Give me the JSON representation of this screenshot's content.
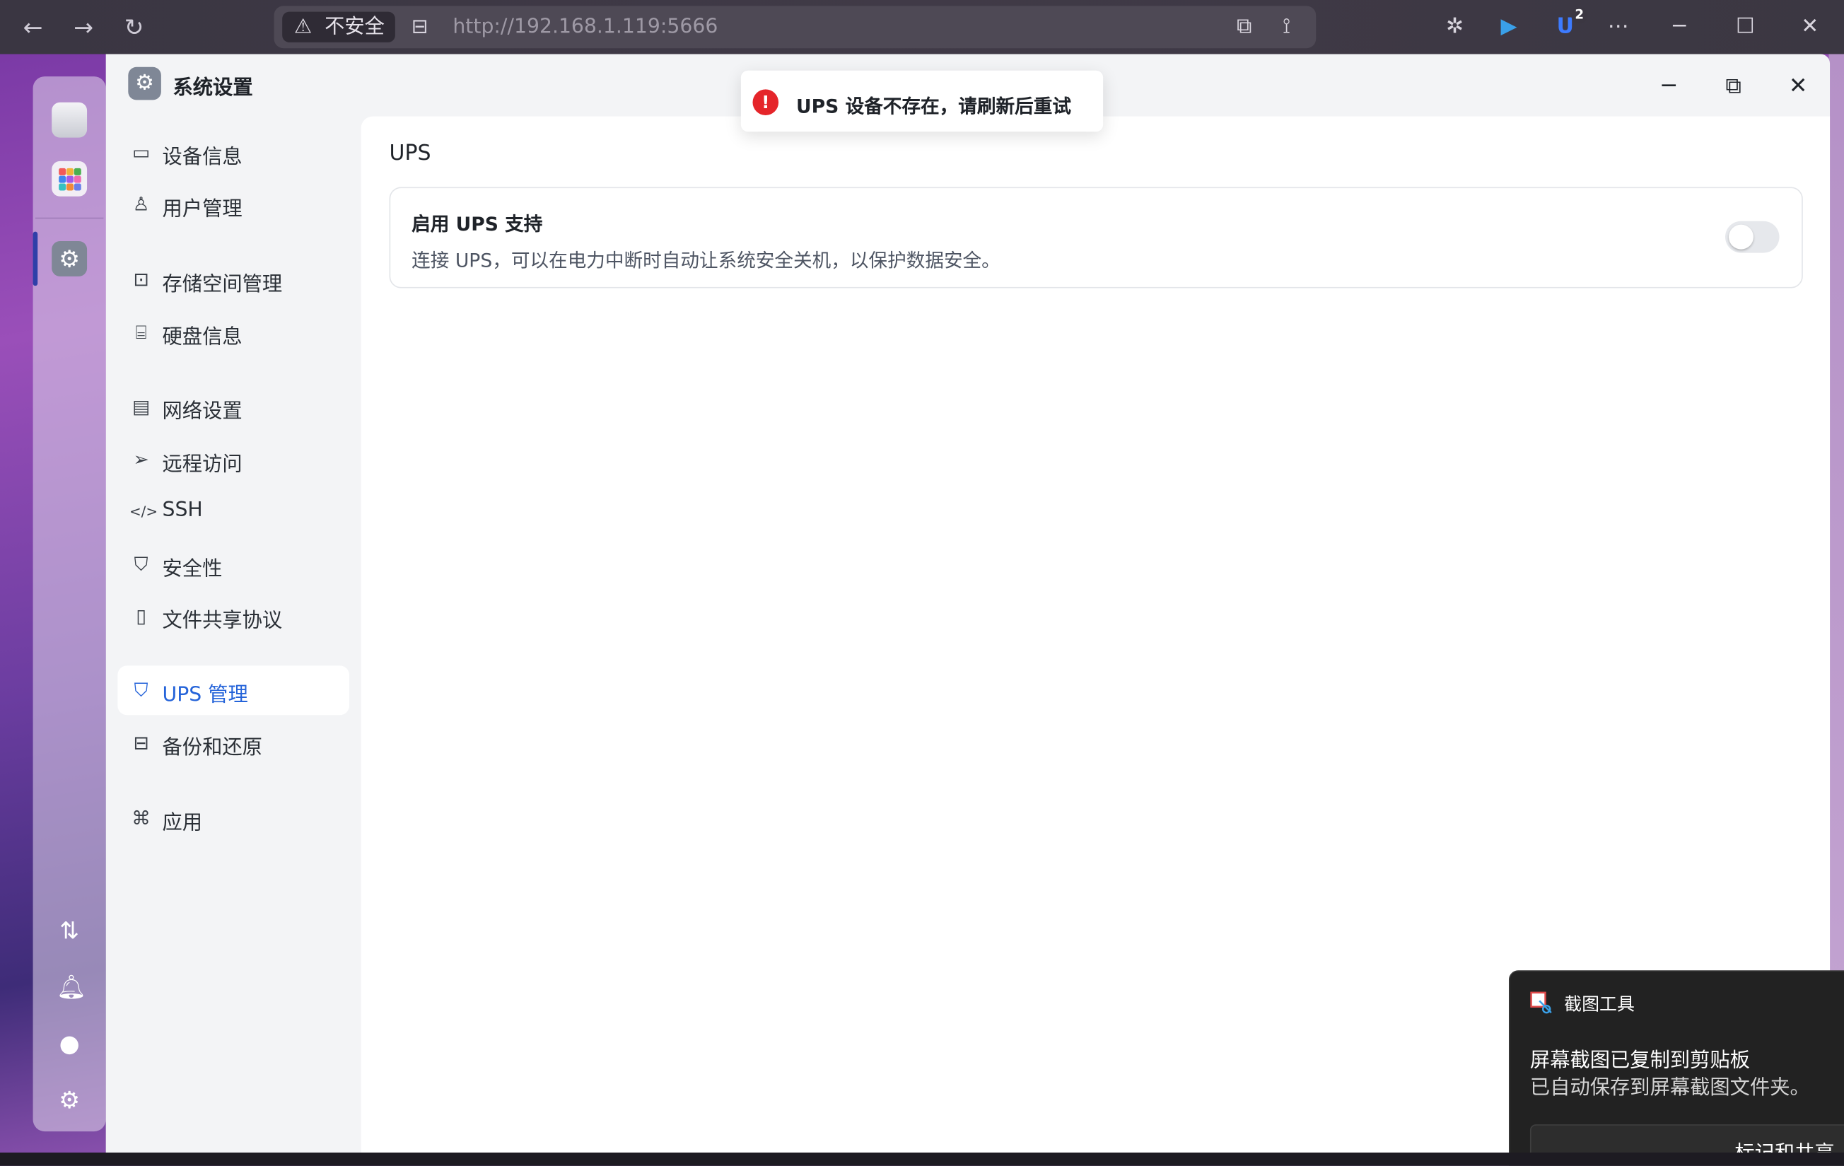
{
  "browser": {
    "security_label": "不安全",
    "url": "http://192.168.1.119:5666",
    "extension_badge": "2"
  },
  "window": {
    "title": "系统设置"
  },
  "sidebar": {
    "items": [
      {
        "label": "设备信息"
      },
      {
        "label": "用户管理"
      },
      {
        "label": "存储空间管理"
      },
      {
        "label": "硬盘信息"
      },
      {
        "label": "网络设置"
      },
      {
        "label": "远程访问"
      },
      {
        "label": "SSH"
      },
      {
        "label": "安全性"
      },
      {
        "label": "文件共享协议"
      },
      {
        "label": "UPS 管理"
      },
      {
        "label": "备份和还原"
      },
      {
        "label": "应用"
      }
    ],
    "active_index": 9
  },
  "main": {
    "title": "UPS",
    "setting": {
      "title": "启用 UPS 支持",
      "description": "连接 UPS，可以在电力中断时自动让系统安全关机，以保护数据安全。",
      "enabled": false
    }
  },
  "toast": {
    "message": "UPS 设备不存在，请刷新后重试",
    "type": "error"
  },
  "notification": {
    "app_name": "截图工具",
    "line1": "屏幕截图已复制到剪贴板",
    "line2": "已自动保存到屏幕截图文件夹。",
    "action": "标记和共享"
  },
  "colors": {
    "accent": "#2463d9",
    "error": "#e5252a"
  }
}
